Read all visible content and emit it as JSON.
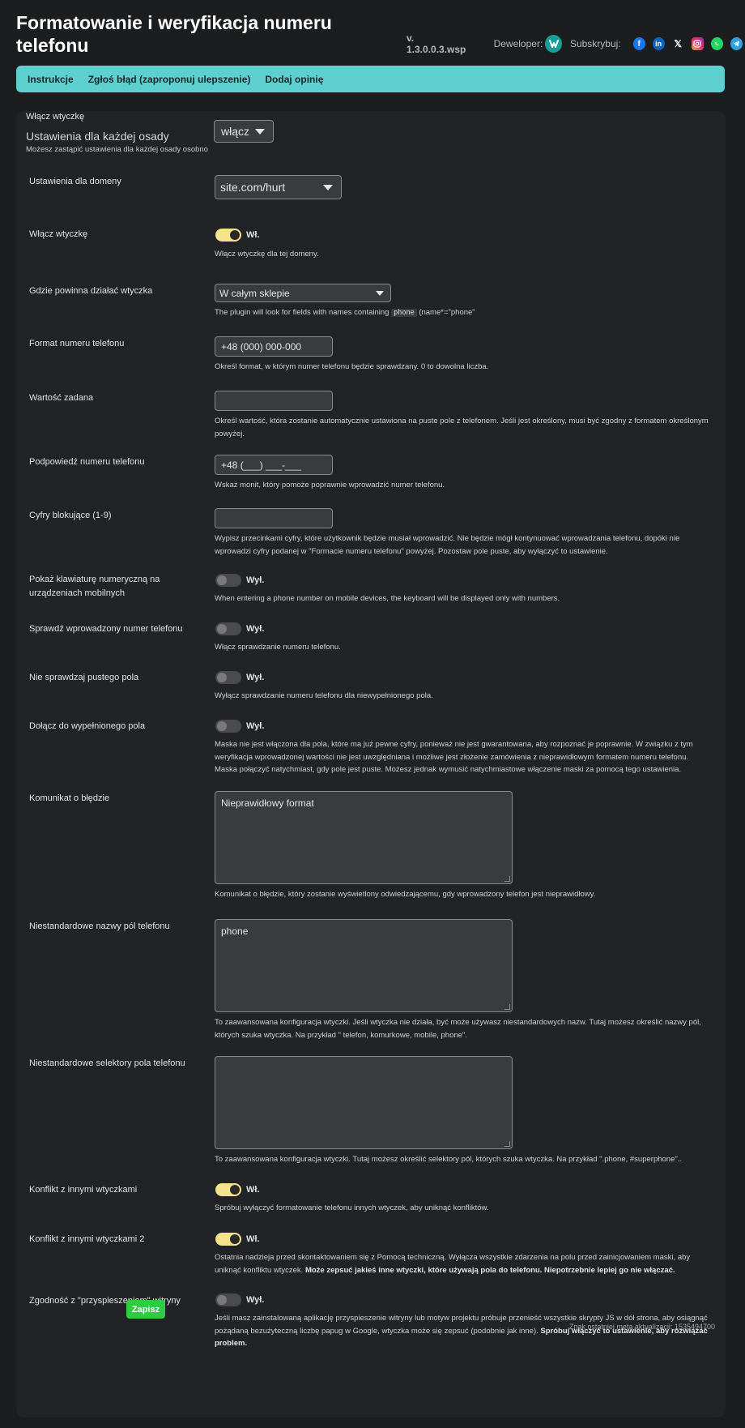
{
  "header": {
    "title": "Formatowanie i weryfikacja numeru telefonu",
    "version": "v. 1.3.0.0.3.wsp",
    "developer_label": "Deweloper:",
    "subscribe_label": "Subskrybuj:",
    "socials": [
      "facebook-icon",
      "linkedin-icon",
      "x-icon",
      "instagram-icon",
      "whatsapp-icon",
      "telegram-icon"
    ]
  },
  "nav": {
    "instructions": "Instrukcje",
    "report": "Zgłoś błąd (zaproponuj ulepszenie)",
    "review": "Dodaj opinię"
  },
  "global": {
    "enable_label": "Włącz wtyczkę",
    "enable_value": "włącz",
    "section_title": "Ustawienia dla każdej osady",
    "section_subtitle": "Możesz zastąpić ustawienia dla każdej osady osobno"
  },
  "settings": {
    "domain": {
      "label": "Ustawienia dla domeny",
      "value": "site.com/hurt"
    },
    "enable": {
      "label": "Włącz wtyczkę",
      "state": "Wł.",
      "desc": "Włącz wtyczkę dla tej domeny."
    },
    "where": {
      "label": "Gdzie powinna działać wtyczka",
      "value": "W całym sklepie",
      "desc_pre": "The plugin will look for fields with names containing",
      "desc_code": "phone",
      "desc_post": "(name*=\"phone\""
    },
    "format": {
      "label": "Format numeru telefonu",
      "value": "+48 (000) 000-000",
      "desc": "Określ format, w którym numer telefonu będzie sprawdzany. 0 to dowolna liczba."
    },
    "default_value": {
      "label": "Wartość zadana",
      "value": "",
      "desc": "Określ wartość, która zostanie automatycznie ustawiona na puste pole z telefonem. Jeśli jest określony, musi być zgodny z formatem określonym powyżej."
    },
    "hint": {
      "label": "Podpowiedź numeru telefonu",
      "value": "+48 (___) ___-___",
      "desc": "Wskaż monit, który pomoże poprawnie wprowadzić numer telefonu."
    },
    "blocking": {
      "label": "Cyfry blokujące (1-9)",
      "value": "",
      "desc": "Wypisz przecinkami cyfry, które użytkownik będzie musiał wprowadzić. Nie będzie mógł kontynuować wprowadzania telefonu, dopóki nie wprowadzi cyfry podanej w \"Formacie numeru telefonu\" powyżej. Pozostaw pole puste, aby wyłączyć to ustawienie."
    },
    "numpad": {
      "label": "Pokaż klawiaturę numeryczną na urządzeniach mobilnych",
      "state": "Wył.",
      "desc": "When entering a phone number on mobile devices, the keyboard will be displayed only with numbers."
    },
    "check": {
      "label": "Sprawdź wprowadzony numer telefonu",
      "state": "Wył.",
      "desc": "Włącz sprawdzanie numeru telefonu."
    },
    "no_empty": {
      "label": "Nie sprawdzaj pustego pola",
      "state": "Wył.",
      "desc": "Wyłącz sprawdzanie numeru telefonu dla niewypełnionego pola."
    },
    "attach": {
      "label": "Dołącz do wypełnionego pola",
      "state": "Wył.",
      "desc": "Maska nie jest włączona dla pola, które ma już pewne cyfry, ponieważ nie jest gwarantowana, aby rozpoznać je poprawnie. W związku z tym weryfikacja wprowadzonej wartości nie jest uwzględniana i możliwe jest złożenie zamówienia z nieprawidłowym formatem numeru telefonu. Maska połączyć natychmiast, gdy pole jest puste. Możesz jednak wymusić natychmiastowe włączenie maski za pomocą tego ustawienia."
    },
    "error_msg": {
      "label": "Komunikat o błędzie",
      "value": "Nieprawidłowy format",
      "desc": "Komunikat o błędzie, który zostanie wyświetlony odwiedzającemu, gdy wprowadzony telefon jest nieprawidłowy."
    },
    "custom_names": {
      "label": "Niestandardowe nazwy pól telefonu",
      "value": "phone",
      "desc": "To zaawansowana konfiguracja wtyczki. Jeśli wtyczka nie działa, być może używasz niestandardowych nazw. Tutaj możesz określić nazwy pól, których szuka wtyczka. Na przykład \" telefon, komurkowe, mobile, phone\"."
    },
    "custom_selectors": {
      "label": "Niestandardowe selektory pola telefonu",
      "value": "",
      "desc": "To zaawansowana konfiguracja wtyczki. Tutaj możesz określić selektory pól, których szuka wtyczka. Na przykład \".phone, #superphone\".."
    },
    "conflict": {
      "label": "Konflikt z innymi wtyczkami",
      "state": "Wł.",
      "desc": "Spróbuj wyłączyć formatowanie telefonu innych wtyczek, aby uniknąć konfliktów."
    },
    "conflict2": {
      "label": "Konflikt z innymi wtyczkami 2",
      "state": "Wł.",
      "desc": "Ostatnia nadzieja przed skontaktowaniem się z Pomocą techniczną. Wyłącza wszystkie zdarzenia na polu przed zainicjowaniem maski, aby uniknąć konfliktu wtyczek.",
      "desc_bold": "Może zepsuć jakieś inne wtyczki, które używają pola do telefonu. Niepotrzebnie lepiej go nie włączać."
    },
    "accel": {
      "label": "Zgodność z \"przyspieszeniem\" witryny",
      "state": "Wył.",
      "desc": "Jeśli masz zainstalowaną aplikację przyspieszenie witryny lub motyw projektu próbuje przenieść wszystkie skrypty JS w dół strona, aby osiągnąć pożądaną bezużyteczną liczbę papug w Google, wtyczka może się zepsuć (podobnie jak inne).",
      "desc_bold": "Spróbuj włączyć to ustawienie, aby rozwiązać problem."
    }
  },
  "save_label": "Zapisz",
  "footer_note": "Znak ostatniej meta aktualizacji: 1535494700"
}
